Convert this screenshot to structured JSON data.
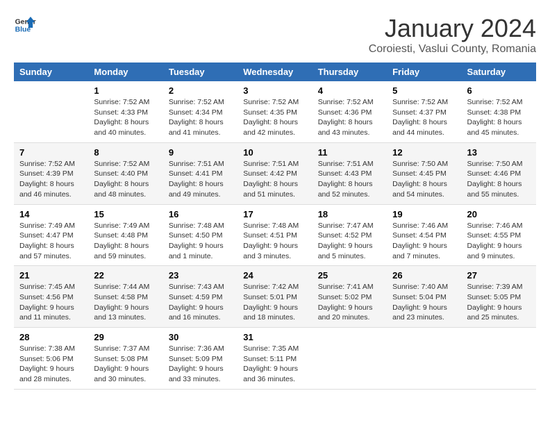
{
  "logo": {
    "line1": "General",
    "line2": "Blue"
  },
  "title": "January 2024",
  "subtitle": "Coroiesti, Vaslui County, Romania",
  "days_of_week": [
    "Sunday",
    "Monday",
    "Tuesday",
    "Wednesday",
    "Thursday",
    "Friday",
    "Saturday"
  ],
  "weeks": [
    [
      {
        "day": "",
        "info": ""
      },
      {
        "day": "1",
        "info": "Sunrise: 7:52 AM\nSunset: 4:33 PM\nDaylight: 8 hours\nand 40 minutes."
      },
      {
        "day": "2",
        "info": "Sunrise: 7:52 AM\nSunset: 4:34 PM\nDaylight: 8 hours\nand 41 minutes."
      },
      {
        "day": "3",
        "info": "Sunrise: 7:52 AM\nSunset: 4:35 PM\nDaylight: 8 hours\nand 42 minutes."
      },
      {
        "day": "4",
        "info": "Sunrise: 7:52 AM\nSunset: 4:36 PM\nDaylight: 8 hours\nand 43 minutes."
      },
      {
        "day": "5",
        "info": "Sunrise: 7:52 AM\nSunset: 4:37 PM\nDaylight: 8 hours\nand 44 minutes."
      },
      {
        "day": "6",
        "info": "Sunrise: 7:52 AM\nSunset: 4:38 PM\nDaylight: 8 hours\nand 45 minutes."
      }
    ],
    [
      {
        "day": "7",
        "info": "Sunrise: 7:52 AM\nSunset: 4:39 PM\nDaylight: 8 hours\nand 46 minutes."
      },
      {
        "day": "8",
        "info": "Sunrise: 7:52 AM\nSunset: 4:40 PM\nDaylight: 8 hours\nand 48 minutes."
      },
      {
        "day": "9",
        "info": "Sunrise: 7:51 AM\nSunset: 4:41 PM\nDaylight: 8 hours\nand 49 minutes."
      },
      {
        "day": "10",
        "info": "Sunrise: 7:51 AM\nSunset: 4:42 PM\nDaylight: 8 hours\nand 51 minutes."
      },
      {
        "day": "11",
        "info": "Sunrise: 7:51 AM\nSunset: 4:43 PM\nDaylight: 8 hours\nand 52 minutes."
      },
      {
        "day": "12",
        "info": "Sunrise: 7:50 AM\nSunset: 4:45 PM\nDaylight: 8 hours\nand 54 minutes."
      },
      {
        "day": "13",
        "info": "Sunrise: 7:50 AM\nSunset: 4:46 PM\nDaylight: 8 hours\nand 55 minutes."
      }
    ],
    [
      {
        "day": "14",
        "info": "Sunrise: 7:49 AM\nSunset: 4:47 PM\nDaylight: 8 hours\nand 57 minutes."
      },
      {
        "day": "15",
        "info": "Sunrise: 7:49 AM\nSunset: 4:48 PM\nDaylight: 8 hours\nand 59 minutes."
      },
      {
        "day": "16",
        "info": "Sunrise: 7:48 AM\nSunset: 4:50 PM\nDaylight: 9 hours\nand 1 minute."
      },
      {
        "day": "17",
        "info": "Sunrise: 7:48 AM\nSunset: 4:51 PM\nDaylight: 9 hours\nand 3 minutes."
      },
      {
        "day": "18",
        "info": "Sunrise: 7:47 AM\nSunset: 4:52 PM\nDaylight: 9 hours\nand 5 minutes."
      },
      {
        "day": "19",
        "info": "Sunrise: 7:46 AM\nSunset: 4:54 PM\nDaylight: 9 hours\nand 7 minutes."
      },
      {
        "day": "20",
        "info": "Sunrise: 7:46 AM\nSunset: 4:55 PM\nDaylight: 9 hours\nand 9 minutes."
      }
    ],
    [
      {
        "day": "21",
        "info": "Sunrise: 7:45 AM\nSunset: 4:56 PM\nDaylight: 9 hours\nand 11 minutes."
      },
      {
        "day": "22",
        "info": "Sunrise: 7:44 AM\nSunset: 4:58 PM\nDaylight: 9 hours\nand 13 minutes."
      },
      {
        "day": "23",
        "info": "Sunrise: 7:43 AM\nSunset: 4:59 PM\nDaylight: 9 hours\nand 16 minutes."
      },
      {
        "day": "24",
        "info": "Sunrise: 7:42 AM\nSunset: 5:01 PM\nDaylight: 9 hours\nand 18 minutes."
      },
      {
        "day": "25",
        "info": "Sunrise: 7:41 AM\nSunset: 5:02 PM\nDaylight: 9 hours\nand 20 minutes."
      },
      {
        "day": "26",
        "info": "Sunrise: 7:40 AM\nSunset: 5:04 PM\nDaylight: 9 hours\nand 23 minutes."
      },
      {
        "day": "27",
        "info": "Sunrise: 7:39 AM\nSunset: 5:05 PM\nDaylight: 9 hours\nand 25 minutes."
      }
    ],
    [
      {
        "day": "28",
        "info": "Sunrise: 7:38 AM\nSunset: 5:06 PM\nDaylight: 9 hours\nand 28 minutes."
      },
      {
        "day": "29",
        "info": "Sunrise: 7:37 AM\nSunset: 5:08 PM\nDaylight: 9 hours\nand 30 minutes."
      },
      {
        "day": "30",
        "info": "Sunrise: 7:36 AM\nSunset: 5:09 PM\nDaylight: 9 hours\nand 33 minutes."
      },
      {
        "day": "31",
        "info": "Sunrise: 7:35 AM\nSunset: 5:11 PM\nDaylight: 9 hours\nand 36 minutes."
      },
      {
        "day": "",
        "info": ""
      },
      {
        "day": "",
        "info": ""
      },
      {
        "day": "",
        "info": ""
      }
    ]
  ]
}
